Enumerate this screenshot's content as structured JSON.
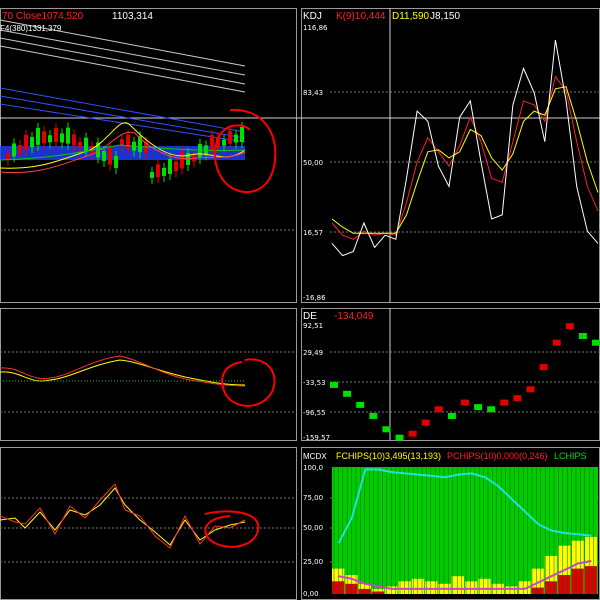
{
  "colors": {
    "background": "#000000",
    "up": "#00e000",
    "down": "#e00000",
    "white": "#ffffff",
    "yellow": "#ffff00",
    "red": "#ff2020",
    "cyan": "#20e0e0",
    "magenta": "#d040d0",
    "green": "#00cc00",
    "blue": "#3050ff",
    "annotation": "#ff0000"
  },
  "main_panel": {
    "close_label": "70  Close1074,520",
    "value": "1103,314",
    "sub_label": "F4(380)1331,379"
  },
  "kdj_panel": {
    "name": "KDJ",
    "k_label": "K(9)10,444",
    "d_label": "D11,590",
    "j_label": "J8,150",
    "axis": [
      "116,86",
      "83,43",
      "50,00",
      "16,57",
      "-16,86"
    ]
  },
  "de_panel": {
    "name": "DE",
    "value": "-134,049",
    "axis": [
      "92,51",
      "29,49",
      "-33,53",
      "-96,55",
      "-159,57"
    ]
  },
  "mcdx_panel": {
    "name": "MCDX",
    "f_label": "FCHIPS(10)3,495(13,193)",
    "p_label": "PCHIPS(10)0,000(0,246)",
    "l_label": "LCHIPS",
    "axis": [
      "100,0",
      "75,00",
      "50,00",
      "25,00",
      "0,00"
    ]
  },
  "chart_data": [
    {
      "type": "line",
      "title": "KDJ",
      "series": [
        {
          "name": "K(9)",
          "values": [
            20,
            14,
            12,
            16,
            14,
            15,
            14,
            30,
            50,
            62,
            55,
            48,
            58,
            72,
            60,
            42,
            40,
            60,
            80,
            78,
            70,
            92,
            85,
            60,
            38,
            26
          ]
        },
        {
          "name": "D",
          "values": [
            22,
            18,
            15,
            15,
            15,
            15,
            15,
            24,
            40,
            55,
            56,
            52,
            55,
            66,
            63,
            52,
            46,
            54,
            70,
            75,
            73,
            86,
            87,
            70,
            50,
            35
          ]
        },
        {
          "name": "J",
          "values": [
            10,
            4,
            6,
            20,
            8,
            14,
            12,
            42,
            75,
            70,
            48,
            38,
            72,
            80,
            50,
            22,
            24,
            78,
            96,
            84,
            60,
            110,
            80,
            38,
            16,
            10
          ]
        }
      ],
      "ylim": [
        -16.86,
        116.86
      ]
    },
    {
      "type": "line",
      "title": "DE",
      "series": [
        {
          "name": "DE",
          "values": [
            -40,
            -60,
            -85,
            -110,
            -140,
            -159,
            -150,
            -125,
            -95,
            -110,
            -80,
            -90,
            -95,
            -80,
            -70,
            -50,
            0,
            55,
            92,
            70,
            55
          ]
        }
      ],
      "ylim": [
        -159.57,
        92.51
      ]
    },
    {
      "type": "area",
      "title": "MCDX",
      "series": [
        {
          "name": "FCHIPS(10)",
          "values": [
            20,
            15,
            8,
            4,
            6,
            10,
            12,
            10,
            8,
            14,
            10,
            12,
            8,
            6,
            10,
            20,
            30,
            38,
            42,
            45
          ]
        },
        {
          "name": "PCHIPS(10)",
          "values": [
            10,
            8,
            4,
            2,
            0,
            0,
            0,
            0,
            0,
            0,
            0,
            0,
            0,
            0,
            0,
            5,
            10,
            15,
            20,
            22
          ]
        },
        {
          "name": "LCHIPS",
          "values": [
            40,
            60,
            98,
            98,
            96,
            95,
            94,
            93,
            92,
            94,
            95,
            92,
            85,
            75,
            65,
            55,
            50,
            48,
            47,
            46
          ]
        }
      ],
      "ylim": [
        0,
        100
      ]
    }
  ]
}
